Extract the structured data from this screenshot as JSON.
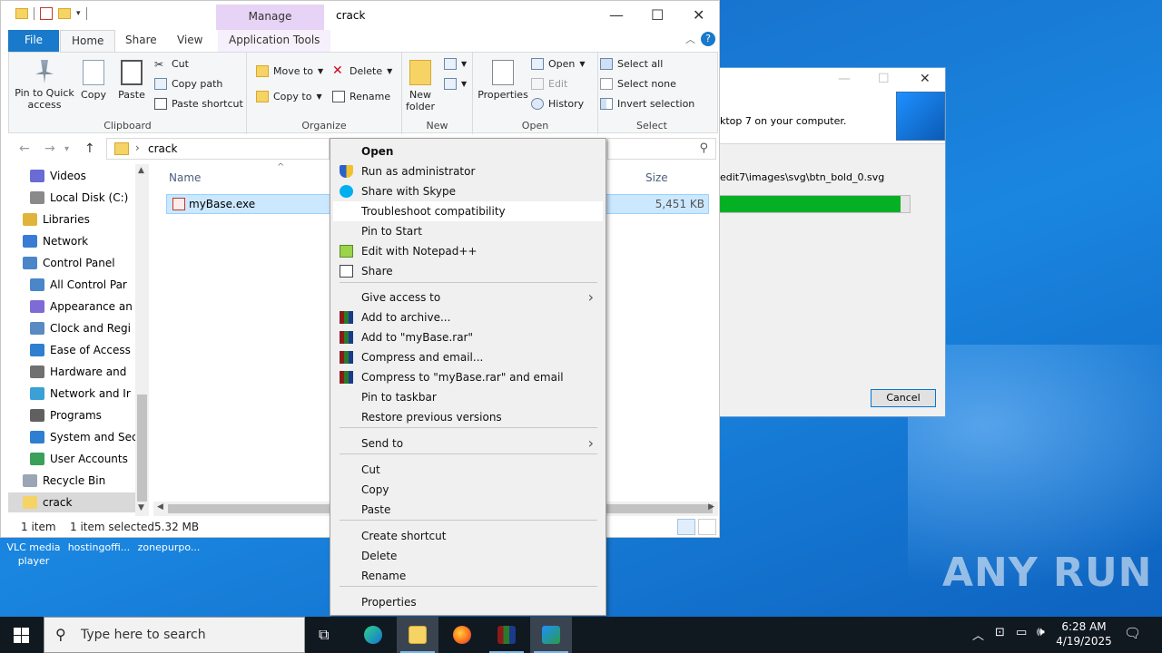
{
  "explorer": {
    "title": "crack",
    "context_tab": "Manage",
    "tabs": [
      "File",
      "Home",
      "Share",
      "View",
      "Application Tools"
    ],
    "ribbon": {
      "clipboard": {
        "label": "Clipboard",
        "pin": "Pin to Quick access",
        "copy": "Copy",
        "paste": "Paste",
        "cut": "Cut",
        "copy_path": "Copy path",
        "paste_shortcut": "Paste shortcut"
      },
      "organize": {
        "label": "Organize",
        "move_to": "Move to",
        "copy_to": "Copy to",
        "delete": "Delete",
        "rename": "Rename"
      },
      "new": {
        "label": "New",
        "new_folder": "New folder"
      },
      "open": {
        "label": "Open",
        "properties": "Properties",
        "open": "Open",
        "edit": "Edit",
        "history": "History"
      },
      "select": {
        "label": "Select",
        "select_all": "Select all",
        "select_none": "Select none",
        "invert": "Invert selection"
      }
    },
    "address": {
      "path": "crack"
    },
    "nav_items": [
      {
        "label": "Videos",
        "color": "#6b6bd6"
      },
      {
        "label": "Local Disk (C:)",
        "color": "#8a8a8a"
      },
      {
        "label": "Libraries",
        "color": "#e0b43a"
      },
      {
        "label": "Network",
        "color": "#3a7bd5"
      },
      {
        "label": "Control Panel",
        "color": "#4a86c8"
      },
      {
        "label": "All Control Par",
        "color": "#4a86c8"
      },
      {
        "label": "Appearance an",
        "color": "#7e6bd6"
      },
      {
        "label": "Clock and Regi",
        "color": "#5a8ac2"
      },
      {
        "label": "Ease of Access",
        "color": "#2f7fd0"
      },
      {
        "label": "Hardware and",
        "color": "#707070"
      },
      {
        "label": "Network and Ir",
        "color": "#3aa0d5"
      },
      {
        "label": "Programs",
        "color": "#606060"
      },
      {
        "label": "System and Sec",
        "color": "#2f7fd0"
      },
      {
        "label": "User Accounts",
        "color": "#3aa05a"
      },
      {
        "label": "Recycle Bin",
        "color": "#9aa5b5"
      },
      {
        "label": "crack",
        "color": "#f6d365"
      }
    ],
    "columns": {
      "name": "Name",
      "size": "Size"
    },
    "files": [
      {
        "name": "myBase.exe",
        "size": "5,451 KB"
      }
    ],
    "status": {
      "count": "1 item",
      "selected": "1 item selected",
      "size": "5.32 MB"
    }
  },
  "installer": {
    "message": "ktop 7 on your computer.",
    "path": "edit7\\images\\svg\\btn_bold_0.svg",
    "progress": 0.95,
    "cancel": "Cancel"
  },
  "context_menu": {
    "items": [
      {
        "label": "Open",
        "bold": true
      },
      {
        "label": "Run as administrator",
        "icon": "shield-icon"
      },
      {
        "label": "Share with Skype",
        "icon": "skype-icon"
      },
      {
        "label": "Troubleshoot compatibility",
        "highlight": true
      },
      {
        "label": "Pin to Start"
      },
      {
        "label": "Edit with Notepad++",
        "icon": "notepadpp-icon"
      },
      {
        "label": "Share",
        "icon": "share-icon"
      },
      {
        "label": "Give access to",
        "submenu": true
      },
      {
        "label": "Add to archive...",
        "icon": "winrar-icon"
      },
      {
        "label": "Add to \"myBase.rar\"",
        "icon": "winrar-icon"
      },
      {
        "label": "Compress and email...",
        "icon": "winrar-icon"
      },
      {
        "label": "Compress to \"myBase.rar\" and email",
        "icon": "winrar-icon"
      },
      {
        "label": "Pin to taskbar"
      },
      {
        "label": "Restore previous versions"
      },
      {
        "label": "Send to",
        "submenu": true
      },
      {
        "label": "Cut"
      },
      {
        "label": "Copy"
      },
      {
        "label": "Paste"
      },
      {
        "label": "Create shortcut"
      },
      {
        "label": "Delete"
      },
      {
        "label": "Rename"
      },
      {
        "label": "Properties"
      }
    ]
  },
  "desktop": {
    "icons": [
      "VLC media player",
      "hostingoffi...",
      "zonepurpo..."
    ],
    "watermark": "ANY RUN"
  },
  "taskbar": {
    "search_placeholder": "Type here to search",
    "time": "6:28 AM",
    "date": "4/19/2025"
  }
}
